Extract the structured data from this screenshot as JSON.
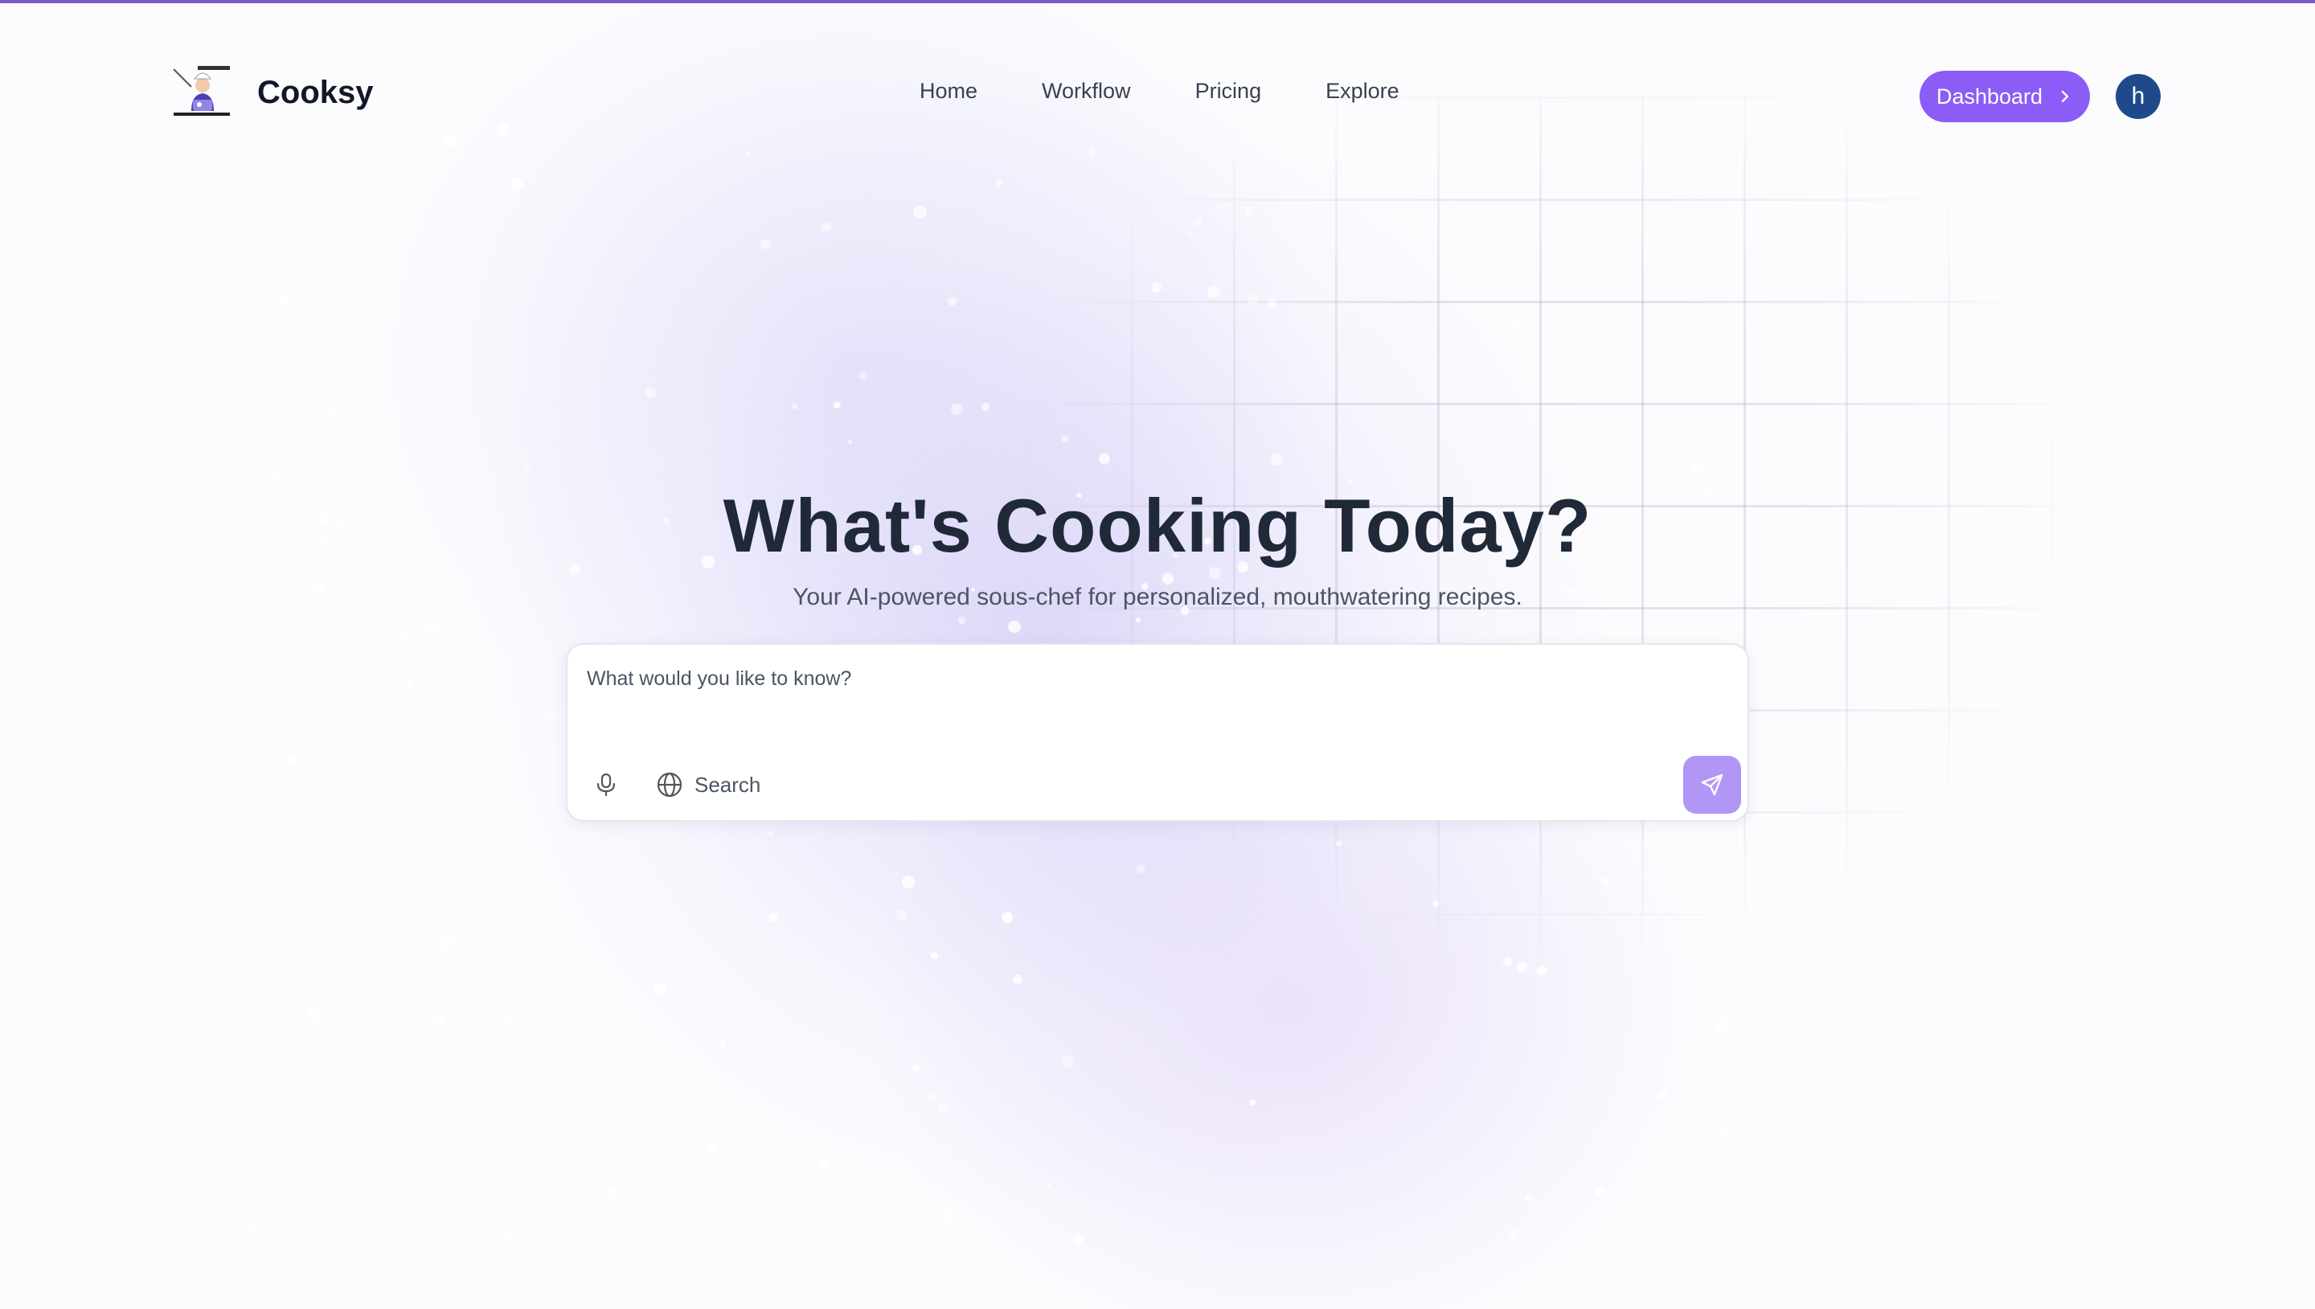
{
  "brand": {
    "name": "Cooksy",
    "logo_icon": "chef-cooking-icon"
  },
  "nav": {
    "items": [
      "Home",
      "Workflow",
      "Pricing",
      "Explore"
    ]
  },
  "header": {
    "dashboard_label": "Dashboard",
    "avatar_initial": "h"
  },
  "hero": {
    "title": "What's Cooking Today?",
    "subtitle": "Your AI-powered sous-chef for personalized, mouthwatering recipes."
  },
  "composer": {
    "placeholder": "What would you like to know?",
    "search_label": "Search",
    "mic_icon": "microphone-icon",
    "search_icon": "globe-icon",
    "send_icon": "send-icon"
  },
  "colors": {
    "accent": "#8b5cf6",
    "send_button": "#b197f5",
    "avatar": "#1e4a8c",
    "top_line": "#7c5cc4"
  }
}
